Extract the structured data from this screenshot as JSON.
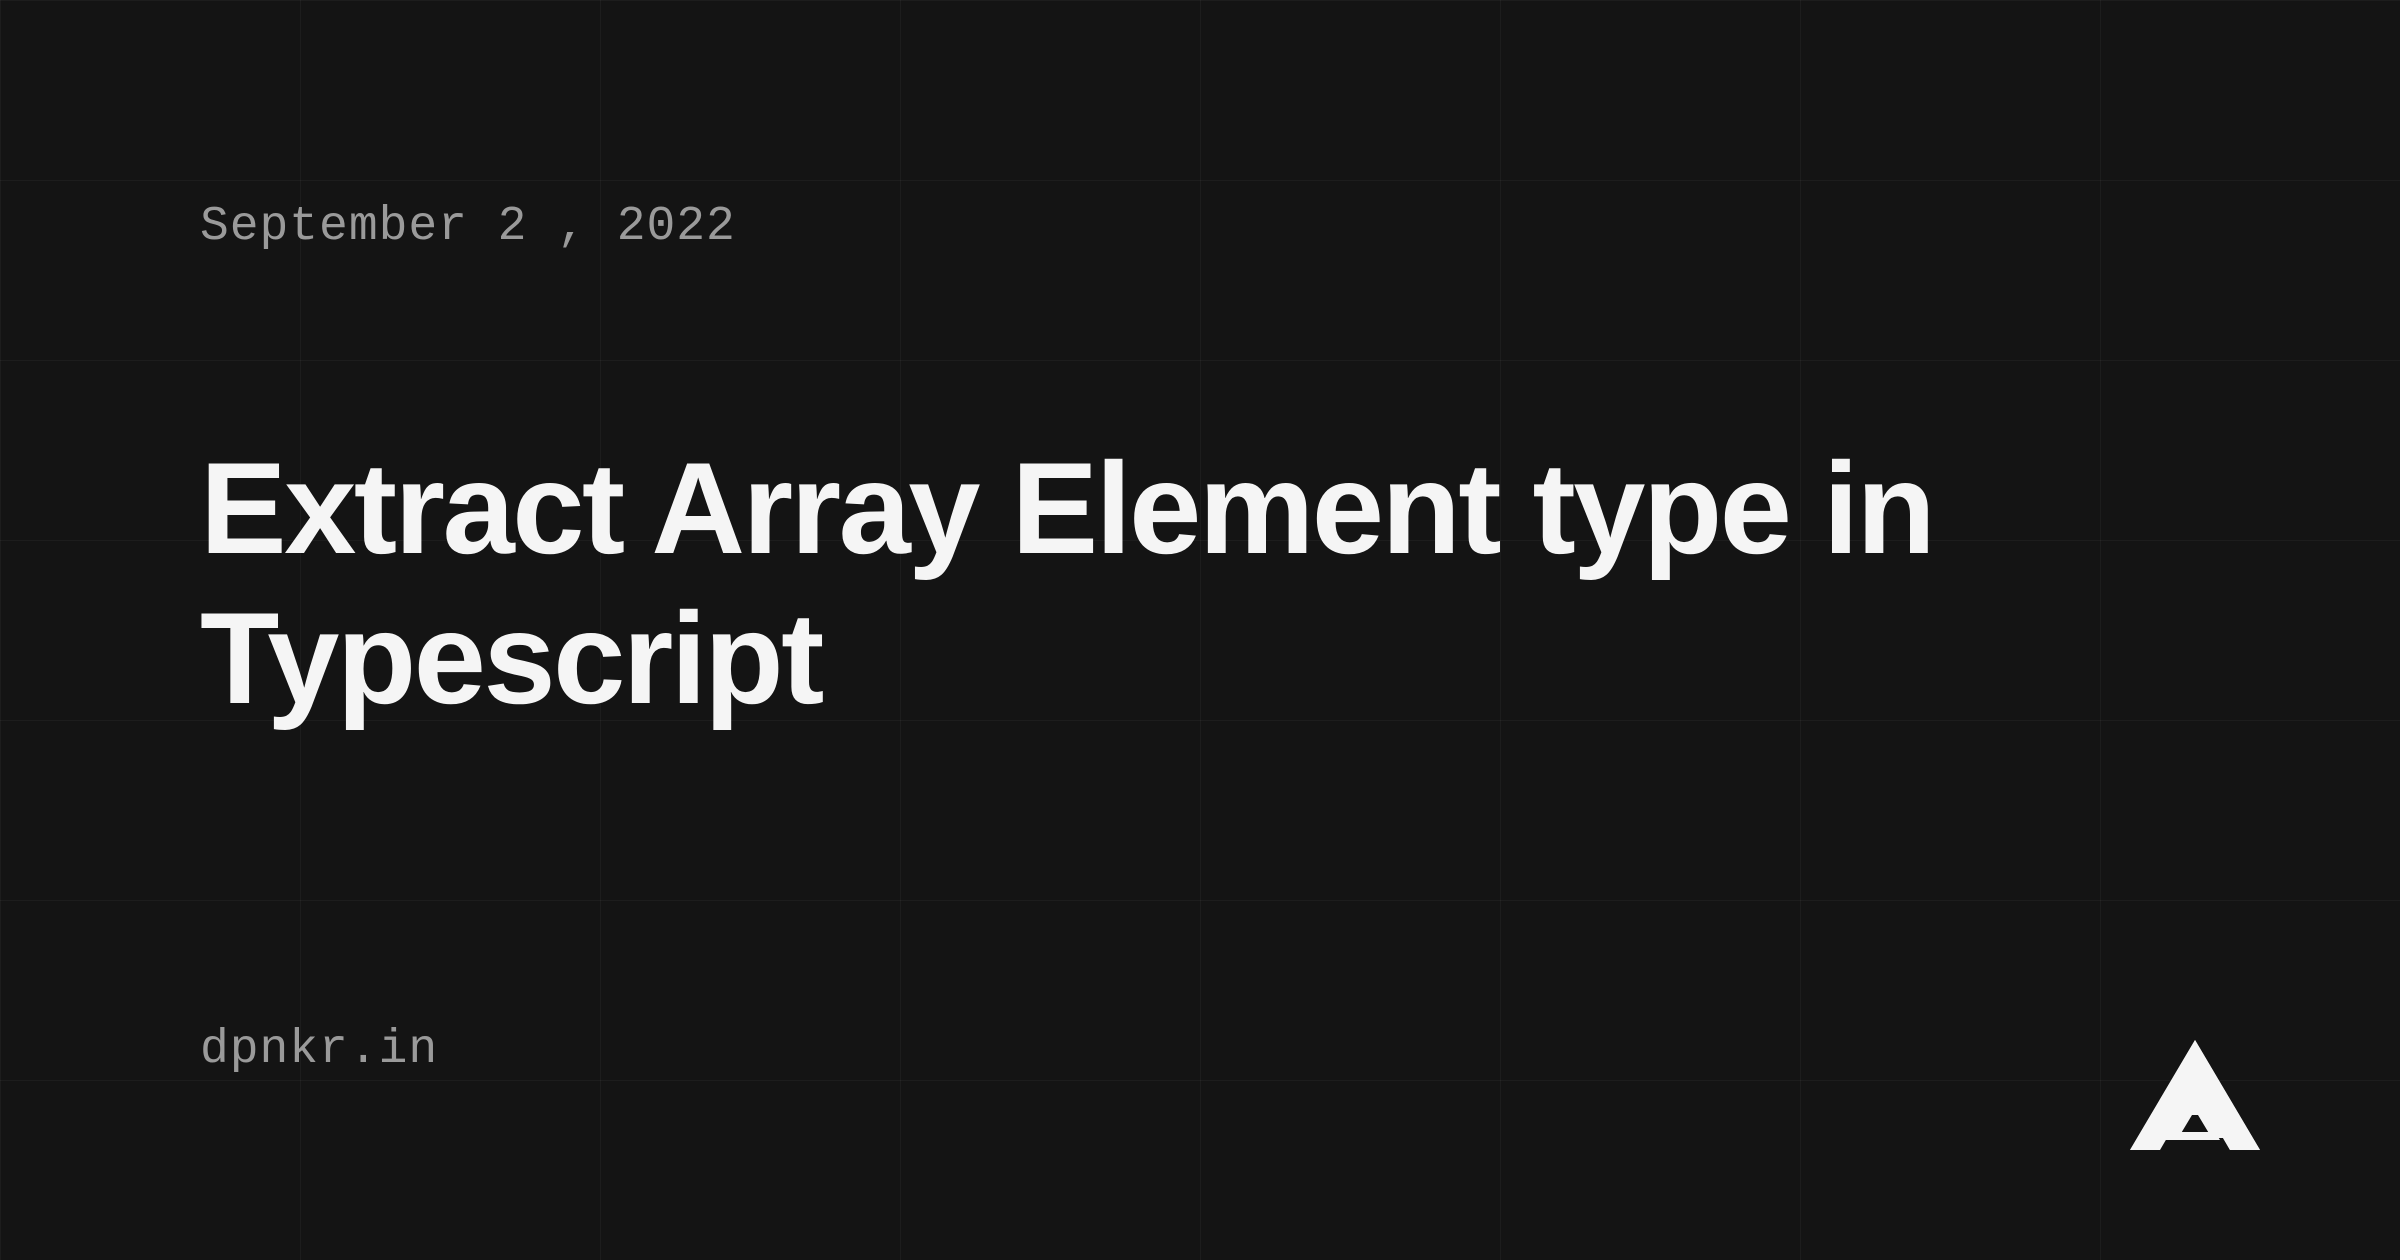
{
  "date": "September 2 , 2022",
  "title": "Extract Array Element type in Typescript",
  "domain": "dpnkr.in"
}
